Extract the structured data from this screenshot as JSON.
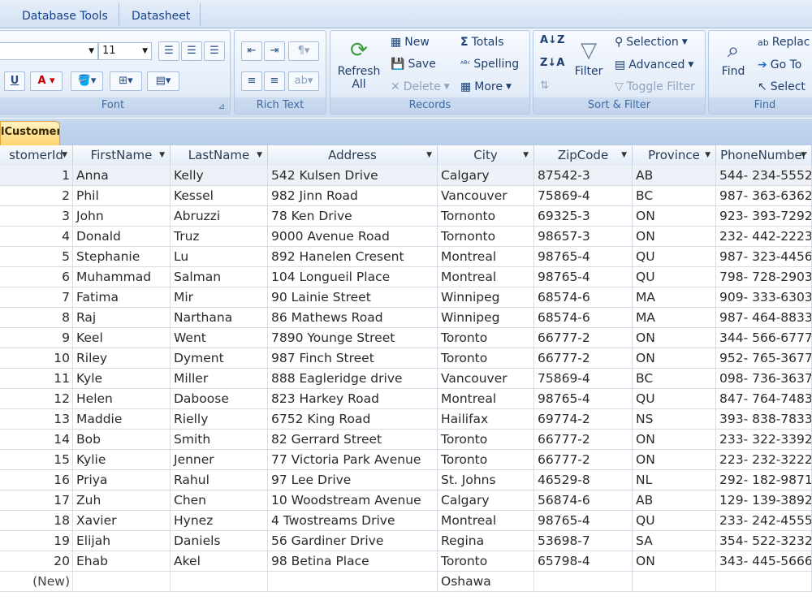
{
  "tabs": [
    "Database Tools",
    "Datasheet"
  ],
  "ribbon": {
    "font": {
      "size": "11",
      "label": "Font"
    },
    "rich_text": {
      "label": "Rich Text"
    },
    "records": {
      "refresh_label": "Refresh All",
      "new_label": "New",
      "save_label": "Save",
      "delete_label": "Delete",
      "totals_label": "Totals",
      "spelling_label": "Spelling",
      "more_label": "More",
      "label": "Records"
    },
    "sort_filter": {
      "filter_label": "Filter",
      "selection_label": "Selection",
      "advanced_label": "Advanced",
      "toggle_filter_label": "Toggle Filter",
      "label": "Sort & Filter"
    },
    "find": {
      "find_label": "Find",
      "replace_label": "Replac",
      "goto_label": "Go To",
      "select_label": "Select",
      "label": "Find"
    }
  },
  "object_tab": "lCustomer",
  "table": {
    "columns": [
      "stomerId",
      "FirstName",
      "LastName",
      "Address",
      "City",
      "ZipCode",
      "Province",
      "PhoneNumber"
    ],
    "rows": [
      [
        "1",
        "Anna",
        "Kelly",
        "542 Kulsen Drive",
        "Calgary",
        "87542-3",
        "AB",
        "544- 234-5552"
      ],
      [
        "2",
        "Phil",
        "Kessel",
        "982 Jinn Road",
        "Vancouver",
        "75869-4",
        "BC",
        "987- 363-6362"
      ],
      [
        "3",
        "John",
        "Abruzzi",
        "78 Ken Drive",
        "Tornonto",
        "69325-3",
        "ON",
        "923- 393-7292"
      ],
      [
        "4",
        "Donald",
        "Truz",
        "9000 Avenue Road",
        "Tornonto",
        "98657-3",
        "ON",
        "232- 442-2223"
      ],
      [
        "5",
        "Stephanie",
        "Lu",
        "892 Hanelen Cresent",
        "Montreal",
        "98765-4",
        "QU",
        "987- 323-4456"
      ],
      [
        "6",
        "Muhammad",
        "Salman",
        "104 Longueil Place",
        "Montreal",
        "98765-4",
        "QU",
        "798- 728-2903"
      ],
      [
        "7",
        "Fatima",
        "Mir",
        "90 Lainie Street",
        "Winnipeg",
        "68574-6",
        "MA",
        "909- 333-6303"
      ],
      [
        "8",
        "Raj",
        "Narthana",
        "86 Mathews Road",
        "Winnipeg",
        "68574-6",
        "MA",
        "987- 464-8833"
      ],
      [
        "9",
        "Keel",
        "Went",
        "7890 Younge Street",
        "Toronto",
        "66777-2",
        "ON",
        "344- 566-6777"
      ],
      [
        "10",
        "Riley",
        "Dyment",
        "987 Finch Street",
        "Toronto",
        "66777-2",
        "ON",
        "952- 765-3677"
      ],
      [
        "11",
        "Kyle",
        "Miller",
        "888 Eagleridge drive",
        "Vancouver",
        "75869-4",
        "BC",
        "098- 736-3637"
      ],
      [
        "12",
        "Helen",
        "Daboose",
        "823 Harkey Road",
        "Montreal",
        "98765-4",
        "QU",
        "847- 764-7483"
      ],
      [
        "13",
        "Maddie",
        "Rielly",
        "6752 King Road",
        "Hailifax",
        "69774-2",
        "NS",
        "393- 838-7833"
      ],
      [
        "14",
        "Bob",
        "Smith",
        "82 Gerrard Street",
        "Toronto",
        "66777-2",
        "ON",
        "233- 322-3392"
      ],
      [
        "15",
        "Kylie",
        "Jenner",
        "77 Victoria Park Avenue",
        "Toronto",
        "66777-2",
        "ON",
        "223- 232-3222"
      ],
      [
        "16",
        "Priya",
        "Rahul",
        "97 Lee Drive",
        "St. Johns",
        "46529-8",
        "NL",
        "292- 182-9871"
      ],
      [
        "17",
        "Zuh",
        "Chen",
        "10 Woodstream Avenue",
        "Calgary",
        "56874-6",
        "AB",
        "129- 139-3892"
      ],
      [
        "18",
        "Xavier",
        "Hynez",
        "4 Twostreams Drive",
        "Montreal",
        "98765-4",
        "QU",
        "233- 242-4555"
      ],
      [
        "19",
        "Elijah",
        "Daniels",
        "56 Gardiner Drive",
        "Regina",
        "53698-7",
        "SA",
        "354- 522-3232"
      ],
      [
        "20",
        "Ehab",
        "Akel",
        "98 Betina Place",
        "Toronto",
        "65798-4",
        "ON",
        "343- 445-5666"
      ],
      [
        "(New)",
        "",
        "",
        "",
        "Oshawa",
        "",
        "",
        ""
      ]
    ]
  }
}
